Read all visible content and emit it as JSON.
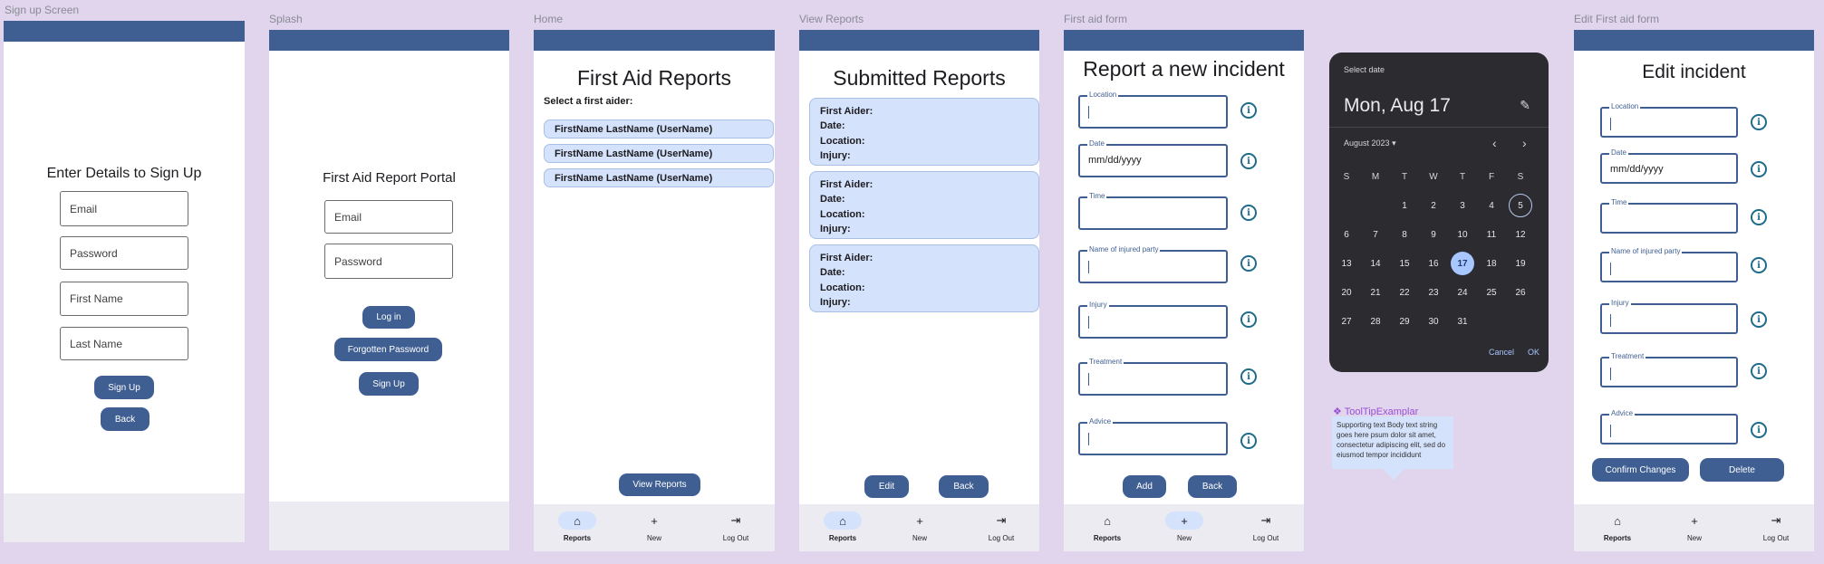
{
  "frame_labels": {
    "signup": "Sign up Screen",
    "splash": "Splash",
    "home": "Home",
    "view_reports": "View Reports",
    "first_aid_form": "First aid form",
    "edit_form": "Edit First aid form"
  },
  "colors": {
    "primary": "#3f5f93",
    "accent_bg": "#d5e2fc",
    "canvas": "#e0d5ec",
    "picker_bg": "#2b2b30"
  },
  "signup": {
    "title": "Enter Details to Sign Up",
    "email": "Email",
    "password": "Password",
    "first_name": "First Name",
    "last_name": "Last Name",
    "signup_btn": "Sign Up",
    "back_btn": "Back"
  },
  "splash": {
    "title": "First Aid Report Portal",
    "email": "Email",
    "password": "Password",
    "login_btn": "Log in",
    "forgot_btn": "Forgotten Password",
    "signup_btn": "Sign Up"
  },
  "home": {
    "title": "First Aid Reports",
    "subtitle": "Select a first aider:",
    "aiders": [
      "FirstName LastName (UserName)",
      "FirstName LastName (UserName)",
      "FirstName LastName (UserName)"
    ],
    "view_btn": "View Reports"
  },
  "view": {
    "title": "Submitted Reports",
    "fields": [
      "First Aider:",
      "Date:",
      "Location:",
      "Injury:"
    ],
    "edit_btn": "Edit",
    "back_btn": "Back"
  },
  "form": {
    "title": "Report a new incident",
    "labels": [
      "Location",
      "Date",
      "Time",
      "Name of injured party",
      "Injury",
      "Treatment",
      "Advice"
    ],
    "date_placeholder": "mm/dd/yyyy",
    "add_btn": "Add",
    "back_btn": "Back"
  },
  "edit": {
    "title": "Edit incident",
    "confirm_btn": "Confirm Changes",
    "delete_btn": "Delete"
  },
  "nav": {
    "reports": "Reports",
    "new": "New",
    "logout": "Log Out"
  },
  "icons": {
    "home": "home-icon",
    "add": "plus-icon",
    "logout": "logout-icon",
    "info": "info-icon",
    "pencil": "pencil-icon"
  },
  "datepicker": {
    "header": "Select date",
    "selected_label": "Mon, Aug 17",
    "month_label": "August 2023",
    "weekdays": [
      "S",
      "M",
      "T",
      "W",
      "T",
      "F",
      "S"
    ],
    "days": [
      "1",
      "2",
      "3",
      "4",
      "5",
      "6",
      "7",
      "8",
      "9",
      "10",
      "11",
      "12",
      "13",
      "14",
      "15",
      "16",
      "17",
      "18",
      "19",
      "20",
      "21",
      "22",
      "23",
      "24",
      "25",
      "26",
      "27",
      "28",
      "29",
      "30",
      "31"
    ],
    "today": "5",
    "selected": "17",
    "cancel": "Cancel",
    "ok": "OK"
  },
  "tooltip": {
    "title": "ToolTipExamplar",
    "body": "Supporting text Body text string goes here psum dolor sit amet, consectetur adipiscing elit, sed do eiusmod tempor incididunt"
  }
}
